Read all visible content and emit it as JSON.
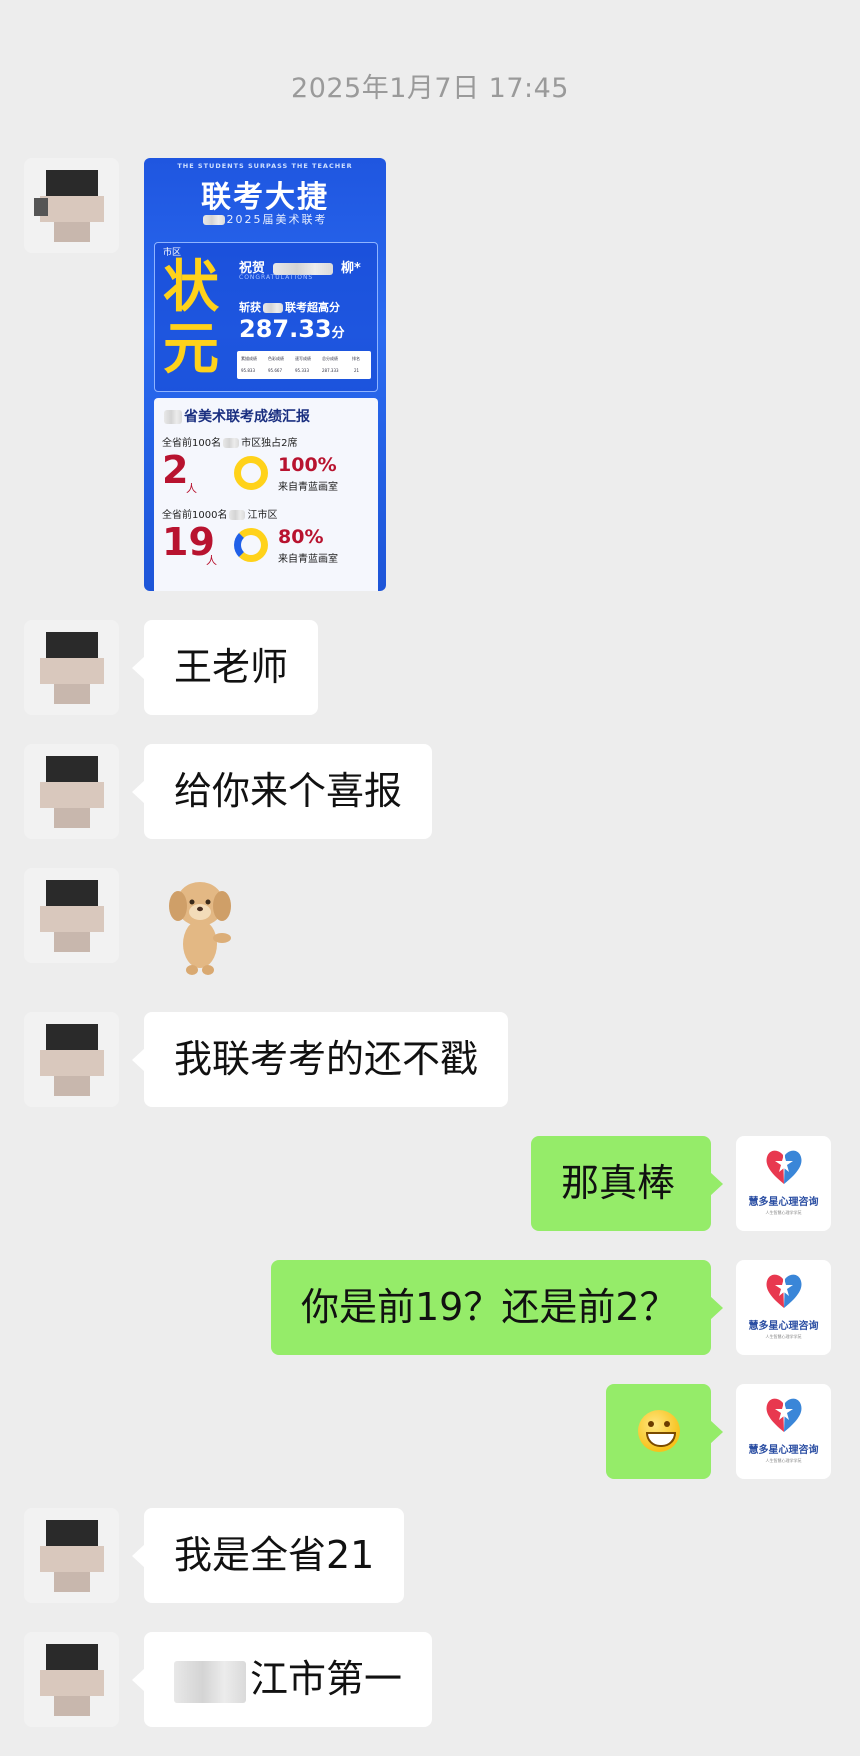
{
  "chat": {
    "timestamp": "2025年1月7日 17:45",
    "messages": [
      {
        "from": "them",
        "type": "image",
        "description": "poster"
      },
      {
        "from": "them",
        "type": "text",
        "text": "王老师"
      },
      {
        "from": "them",
        "type": "text",
        "text": "给你来个喜报"
      },
      {
        "from": "them",
        "type": "sticker"
      },
      {
        "from": "them",
        "type": "text",
        "text": "我联考考的还不戳"
      },
      {
        "from": "me",
        "type": "text",
        "text": "那真棒"
      },
      {
        "from": "me",
        "type": "text",
        "text": "你是前19？还是前2？"
      },
      {
        "from": "me",
        "type": "emoji",
        "icon": "grinning-face"
      },
      {
        "from": "them",
        "type": "text",
        "text": "我是全省21"
      },
      {
        "from": "them",
        "type": "text",
        "text": "江市第一",
        "prefix_blurred": true
      }
    ]
  },
  "poster": {
    "tagline": "THE STUDENTS SURPASS THE TEACHER",
    "title": "联考大捷",
    "subtitle": "2025届美术联考",
    "city_label": "市区",
    "zhuangyuan": "状元",
    "congrats": "祝贺",
    "student_name": "柳*",
    "congrats_en": "CONGRATULATIONS",
    "high_score_label": "联考超高分",
    "high_score_prefix": "斩获",
    "score": "287.33",
    "score_unit": "分",
    "table_headers": [
      "素描成绩",
      "色彩成绩",
      "速写成绩",
      "总分成绩",
      "排名"
    ],
    "table_values": [
      "95.833",
      "95.667",
      "95.333",
      "287.333",
      "21"
    ],
    "report_title": "省美术联考成绩汇报",
    "top100_label": "全省前100名",
    "top100_suffix": "市区独占2席",
    "top100_count": "2",
    "top100_pct": "100%",
    "top1000_label": "全省前1000名",
    "top1000_suffix": "江市区",
    "top1000_count": "19",
    "top1000_pct": "80%",
    "person_unit": "人",
    "from_studio": "来自青蓝画室"
  },
  "brand": {
    "name": "慧多星心理咨询",
    "small": "人生智慧心理学学苑"
  },
  "colors": {
    "background": "#ededed",
    "incoming_bubble": "#ffffff",
    "outgoing_bubble": "#95ec69",
    "poster_blue": "#1f56e0",
    "poster_yellow": "#ffd21a",
    "poster_red": "#b8132f"
  }
}
